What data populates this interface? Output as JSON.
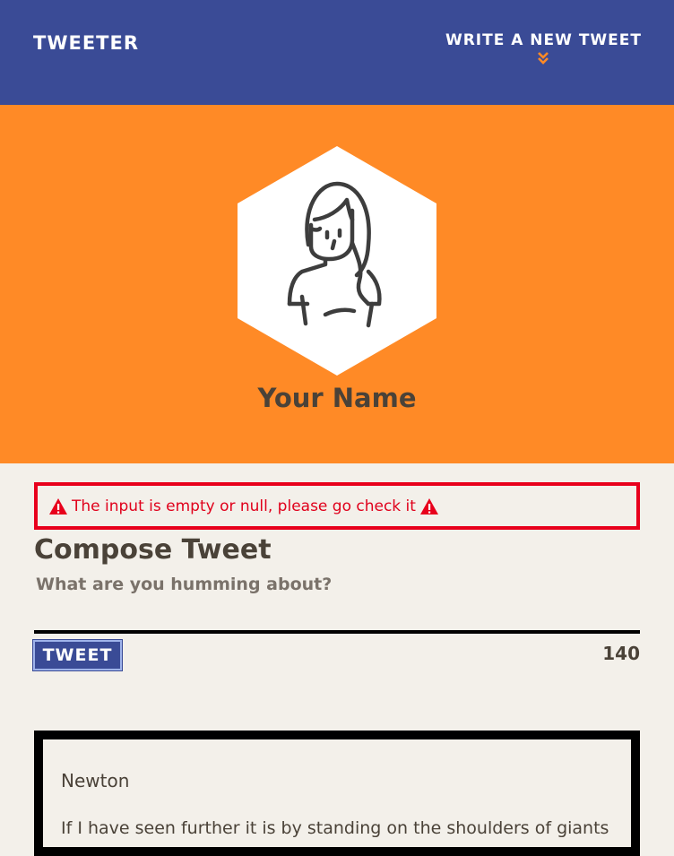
{
  "nav": {
    "brand": "TWEETER",
    "compose_link": "WRITE A NEW TWEET",
    "chevron_icon": "double-chevron-down-icon",
    "chevron_color": "#ff8a26",
    "background": "#3a4b96"
  },
  "profile": {
    "name": "Your Name",
    "avatar_icon": "user-avatar-icon",
    "background": "#ff8a26"
  },
  "error": {
    "message": "The input is empty or null, please go check it",
    "icon": "warning-icon",
    "color": "#e8001c"
  },
  "compose": {
    "title": "Compose Tweet",
    "placeholder": "What are you humming about?",
    "value": "",
    "button_label": "TWEET",
    "counter": "140"
  },
  "tweets": [
    {
      "author": "Newton",
      "text": "If I have seen further it is by standing on the shoulders of giants"
    }
  ]
}
